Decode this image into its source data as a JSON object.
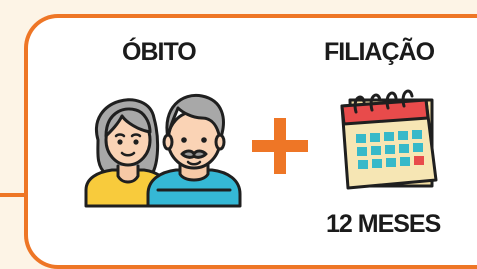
{
  "labels": {
    "obito": "ÓBITO",
    "filiacao": "FILIAÇÃO",
    "meses": "12 MESES"
  },
  "icons": {
    "couple": "elderly-couple-icon",
    "plus": "plus-icon",
    "calendar": "calendar-icon"
  },
  "colors": {
    "accent": "#EE7626",
    "background": "#FDF4E6",
    "card": "#FFFFFF",
    "text": "#1B1B1B"
  }
}
